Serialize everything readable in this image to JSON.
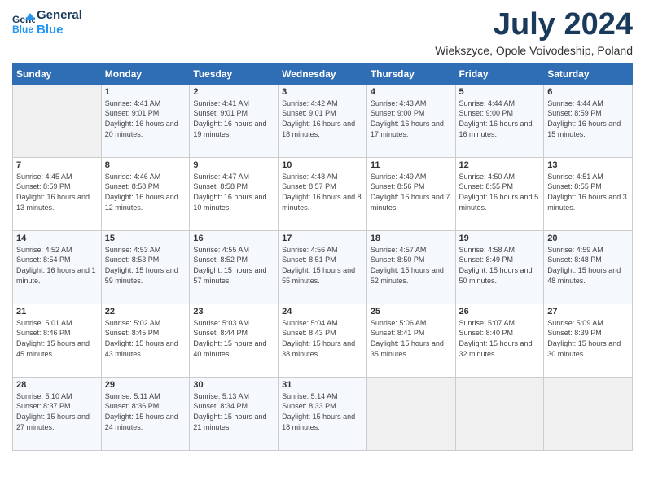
{
  "header": {
    "logo_line1": "General",
    "logo_line2": "Blue",
    "month": "July 2024",
    "location": "Wiekszyce, Opole Voivodeship, Poland"
  },
  "weekdays": [
    "Sunday",
    "Monday",
    "Tuesday",
    "Wednesday",
    "Thursday",
    "Friday",
    "Saturday"
  ],
  "weeks": [
    [
      {
        "day": "",
        "sunrise": "",
        "sunset": "",
        "daylight": ""
      },
      {
        "day": "1",
        "sunrise": "Sunrise: 4:41 AM",
        "sunset": "Sunset: 9:01 PM",
        "daylight": "Daylight: 16 hours and 20 minutes."
      },
      {
        "day": "2",
        "sunrise": "Sunrise: 4:41 AM",
        "sunset": "Sunset: 9:01 PM",
        "daylight": "Daylight: 16 hours and 19 minutes."
      },
      {
        "day": "3",
        "sunrise": "Sunrise: 4:42 AM",
        "sunset": "Sunset: 9:01 PM",
        "daylight": "Daylight: 16 hours and 18 minutes."
      },
      {
        "day": "4",
        "sunrise": "Sunrise: 4:43 AM",
        "sunset": "Sunset: 9:00 PM",
        "daylight": "Daylight: 16 hours and 17 minutes."
      },
      {
        "day": "5",
        "sunrise": "Sunrise: 4:44 AM",
        "sunset": "Sunset: 9:00 PM",
        "daylight": "Daylight: 16 hours and 16 minutes."
      },
      {
        "day": "6",
        "sunrise": "Sunrise: 4:44 AM",
        "sunset": "Sunset: 8:59 PM",
        "daylight": "Daylight: 16 hours and 15 minutes."
      }
    ],
    [
      {
        "day": "7",
        "sunrise": "Sunrise: 4:45 AM",
        "sunset": "Sunset: 8:59 PM",
        "daylight": "Daylight: 16 hours and 13 minutes."
      },
      {
        "day": "8",
        "sunrise": "Sunrise: 4:46 AM",
        "sunset": "Sunset: 8:58 PM",
        "daylight": "Daylight: 16 hours and 12 minutes."
      },
      {
        "day": "9",
        "sunrise": "Sunrise: 4:47 AM",
        "sunset": "Sunset: 8:58 PM",
        "daylight": "Daylight: 16 hours and 10 minutes."
      },
      {
        "day": "10",
        "sunrise": "Sunrise: 4:48 AM",
        "sunset": "Sunset: 8:57 PM",
        "daylight": "Daylight: 16 hours and 8 minutes."
      },
      {
        "day": "11",
        "sunrise": "Sunrise: 4:49 AM",
        "sunset": "Sunset: 8:56 PM",
        "daylight": "Daylight: 16 hours and 7 minutes."
      },
      {
        "day": "12",
        "sunrise": "Sunrise: 4:50 AM",
        "sunset": "Sunset: 8:55 PM",
        "daylight": "Daylight: 16 hours and 5 minutes."
      },
      {
        "day": "13",
        "sunrise": "Sunrise: 4:51 AM",
        "sunset": "Sunset: 8:55 PM",
        "daylight": "Daylight: 16 hours and 3 minutes."
      }
    ],
    [
      {
        "day": "14",
        "sunrise": "Sunrise: 4:52 AM",
        "sunset": "Sunset: 8:54 PM",
        "daylight": "Daylight: 16 hours and 1 minute."
      },
      {
        "day": "15",
        "sunrise": "Sunrise: 4:53 AM",
        "sunset": "Sunset: 8:53 PM",
        "daylight": "Daylight: 15 hours and 59 minutes."
      },
      {
        "day": "16",
        "sunrise": "Sunrise: 4:55 AM",
        "sunset": "Sunset: 8:52 PM",
        "daylight": "Daylight: 15 hours and 57 minutes."
      },
      {
        "day": "17",
        "sunrise": "Sunrise: 4:56 AM",
        "sunset": "Sunset: 8:51 PM",
        "daylight": "Daylight: 15 hours and 55 minutes."
      },
      {
        "day": "18",
        "sunrise": "Sunrise: 4:57 AM",
        "sunset": "Sunset: 8:50 PM",
        "daylight": "Daylight: 15 hours and 52 minutes."
      },
      {
        "day": "19",
        "sunrise": "Sunrise: 4:58 AM",
        "sunset": "Sunset: 8:49 PM",
        "daylight": "Daylight: 15 hours and 50 minutes."
      },
      {
        "day": "20",
        "sunrise": "Sunrise: 4:59 AM",
        "sunset": "Sunset: 8:48 PM",
        "daylight": "Daylight: 15 hours and 48 minutes."
      }
    ],
    [
      {
        "day": "21",
        "sunrise": "Sunrise: 5:01 AM",
        "sunset": "Sunset: 8:46 PM",
        "daylight": "Daylight: 15 hours and 45 minutes."
      },
      {
        "day": "22",
        "sunrise": "Sunrise: 5:02 AM",
        "sunset": "Sunset: 8:45 PM",
        "daylight": "Daylight: 15 hours and 43 minutes."
      },
      {
        "day": "23",
        "sunrise": "Sunrise: 5:03 AM",
        "sunset": "Sunset: 8:44 PM",
        "daylight": "Daylight: 15 hours and 40 minutes."
      },
      {
        "day": "24",
        "sunrise": "Sunrise: 5:04 AM",
        "sunset": "Sunset: 8:43 PM",
        "daylight": "Daylight: 15 hours and 38 minutes."
      },
      {
        "day": "25",
        "sunrise": "Sunrise: 5:06 AM",
        "sunset": "Sunset: 8:41 PM",
        "daylight": "Daylight: 15 hours and 35 minutes."
      },
      {
        "day": "26",
        "sunrise": "Sunrise: 5:07 AM",
        "sunset": "Sunset: 8:40 PM",
        "daylight": "Daylight: 15 hours and 32 minutes."
      },
      {
        "day": "27",
        "sunrise": "Sunrise: 5:09 AM",
        "sunset": "Sunset: 8:39 PM",
        "daylight": "Daylight: 15 hours and 30 minutes."
      }
    ],
    [
      {
        "day": "28",
        "sunrise": "Sunrise: 5:10 AM",
        "sunset": "Sunset: 8:37 PM",
        "daylight": "Daylight: 15 hours and 27 minutes."
      },
      {
        "day": "29",
        "sunrise": "Sunrise: 5:11 AM",
        "sunset": "Sunset: 8:36 PM",
        "daylight": "Daylight: 15 hours and 24 minutes."
      },
      {
        "day": "30",
        "sunrise": "Sunrise: 5:13 AM",
        "sunset": "Sunset: 8:34 PM",
        "daylight": "Daylight: 15 hours and 21 minutes."
      },
      {
        "day": "31",
        "sunrise": "Sunrise: 5:14 AM",
        "sunset": "Sunset: 8:33 PM",
        "daylight": "Daylight: 15 hours and 18 minutes."
      },
      {
        "day": "",
        "sunrise": "",
        "sunset": "",
        "daylight": ""
      },
      {
        "day": "",
        "sunrise": "",
        "sunset": "",
        "daylight": ""
      },
      {
        "day": "",
        "sunrise": "",
        "sunset": "",
        "daylight": ""
      }
    ]
  ]
}
